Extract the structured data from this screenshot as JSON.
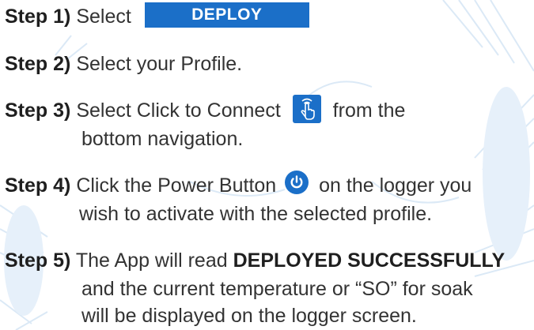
{
  "colors": {
    "accent": "#1b6fc8",
    "text": "#333333",
    "watermark": "#dbe9f6"
  },
  "steps": [
    {
      "label": "Step 1)",
      "text_before": "Select",
      "button_label": "DEPLOY"
    },
    {
      "label": "Step 2)",
      "text": "Select your Profile."
    },
    {
      "label": "Step 3)",
      "text_before": "Select Click to Connect",
      "icon": "tap-hand-icon",
      "text_after": "from the",
      "line2": "bottom navigation."
    },
    {
      "label": "Step 4)",
      "text_before": "Click the Power Button",
      "icon": "power-icon",
      "text_after": "on the logger you",
      "line2": "wish to activate with the selected profile."
    },
    {
      "label": "Step 5)",
      "text_before": "The App will read",
      "bold_text": "DEPLOYED SUCCESSFULLY",
      "line2": "and the current temperature or “SO” for soak",
      "line3": "will be displayed on the logger screen."
    }
  ]
}
